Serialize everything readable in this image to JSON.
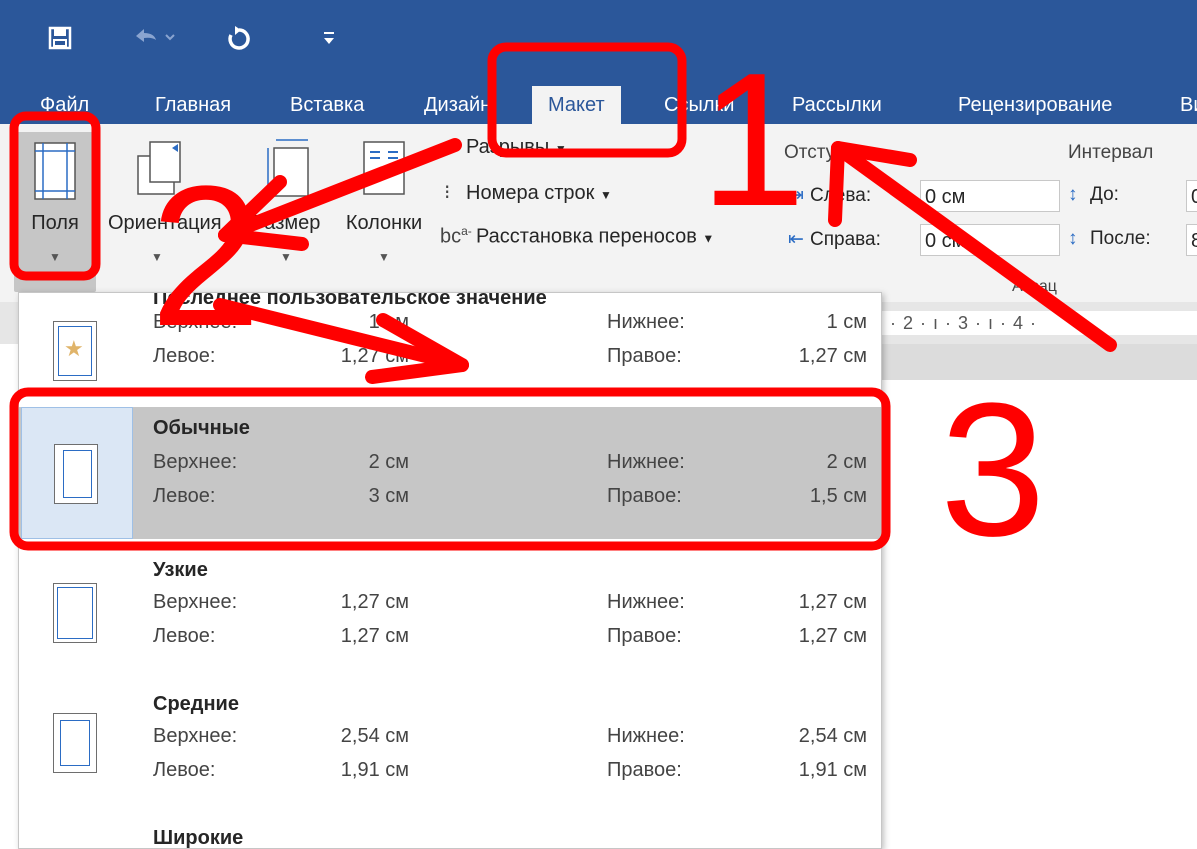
{
  "quick_access": {
    "save_icon": "save-icon",
    "undo_icon": "undo-icon",
    "redo_icon": "repeat-icon",
    "customize_icon": "customize-qat-icon"
  },
  "tabs": [
    {
      "label": "Файл"
    },
    {
      "label": "Главная"
    },
    {
      "label": "Вставка"
    },
    {
      "label": "Дизайн"
    },
    {
      "label": "Макет"
    },
    {
      "label": "Ссылки"
    },
    {
      "label": "Рассылки"
    },
    {
      "label": "Рецензирование"
    },
    {
      "label": "Ви"
    }
  ],
  "ribbon": {
    "fields_label": "Поля",
    "orientation_label": "Ориентация",
    "size_label": "Размер",
    "columns_label": "Колонки",
    "breaks_label": "Разрывы",
    "line_numbers_label": "Номера строк",
    "hyphenation_label": "Расстановка переносов",
    "indent_group_label": "Отступ",
    "left_label": "Слева:",
    "left_value": "0 см",
    "right_label": "Справа:",
    "right_value": "0 см",
    "interval_label": "Интервал",
    "before_label": "До:",
    "after_label": "После:",
    "before_value": "0",
    "after_value": "8",
    "paragraph_group_label": "Абзац"
  },
  "ruler_text": "· 2 · ı · 3 · ı · 4 ·",
  "margins_menu": {
    "options": [
      {
        "title": "Последнее пользовательское значение",
        "top_label": "Верхнее:",
        "top": "1 см",
        "bottom_label": "Нижнее:",
        "bottom": "1 см",
        "left_label": "Левое:",
        "left": "1,27 см",
        "right_label": "Правое:",
        "right": "1,27 см"
      },
      {
        "title": "Обычные",
        "top_label": "Верхнее:",
        "top": "2 см",
        "bottom_label": "Нижнее:",
        "bottom": "2 см",
        "left_label": "Левое:",
        "left": "3 см",
        "right_label": "Правое:",
        "right": "1,5 см"
      },
      {
        "title": "Узкие",
        "top_label": "Верхнее:",
        "top": "1,27 см",
        "bottom_label": "Нижнее:",
        "bottom": "1,27 см",
        "left_label": "Левое:",
        "left": "1,27 см",
        "right_label": "Правое:",
        "right": "1,27 см"
      },
      {
        "title": "Средние",
        "top_label": "Верхнее:",
        "top": "2,54 см",
        "bottom_label": "Нижнее:",
        "bottom": "2,54 см",
        "left_label": "Левое:",
        "left": "1,91 см",
        "right_label": "Правое:",
        "right": "1,91 см"
      },
      {
        "title": "Широкие"
      }
    ]
  },
  "annotations": {
    "step1": "1",
    "step2": "2",
    "step3": "3",
    "color": "#ff0000"
  }
}
